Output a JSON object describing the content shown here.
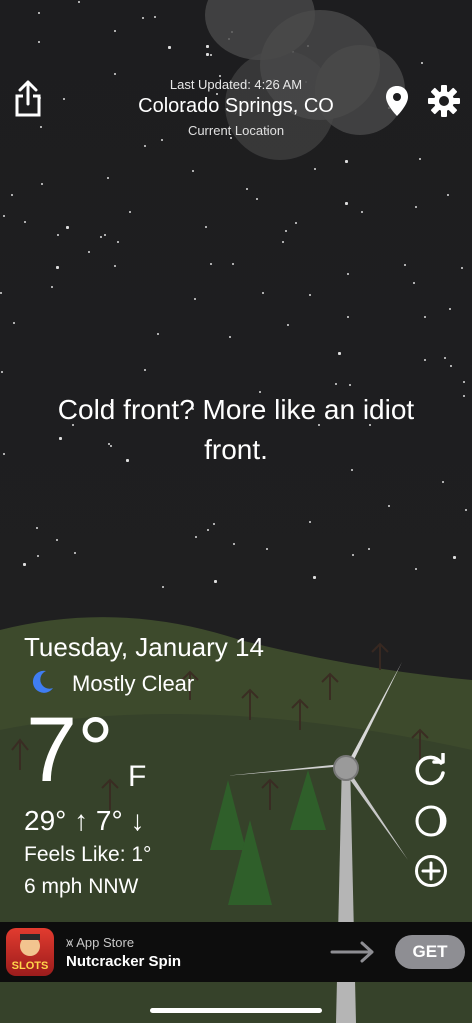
{
  "header": {
    "last_updated": "Last Updated: 4:26 AM",
    "city": "Colorado Springs, CO",
    "location_label": "Current Location"
  },
  "icons": {
    "share": "share-icon",
    "location": "location-pin-icon",
    "settings": "gear-icon",
    "condition": "crescent-moon-icon",
    "refresh": "refresh-icon",
    "moon_phase": "moon-phase-icon",
    "add": "add-location-icon"
  },
  "quip": "Cold front? More like an idiot front.",
  "weather": {
    "date": "Tuesday, January 14",
    "condition": "Mostly Clear",
    "temperature": "7°",
    "unit": "F",
    "hi_lo": "29° ↑ 7° ↓",
    "feels_like": "Feels Like: 1°",
    "wind": "6 mph NNW"
  },
  "ad": {
    "source": "App Store",
    "title": "Nutcracker Spin",
    "cta": "GET",
    "icon_text": "SLOTS"
  },
  "colors": {
    "sky": "#1d1d1f",
    "hill": "#3d4a2c",
    "tree": "#2f5f2a",
    "ad_bar": "#0d0d0d",
    "get_button": "#8e8e93"
  }
}
